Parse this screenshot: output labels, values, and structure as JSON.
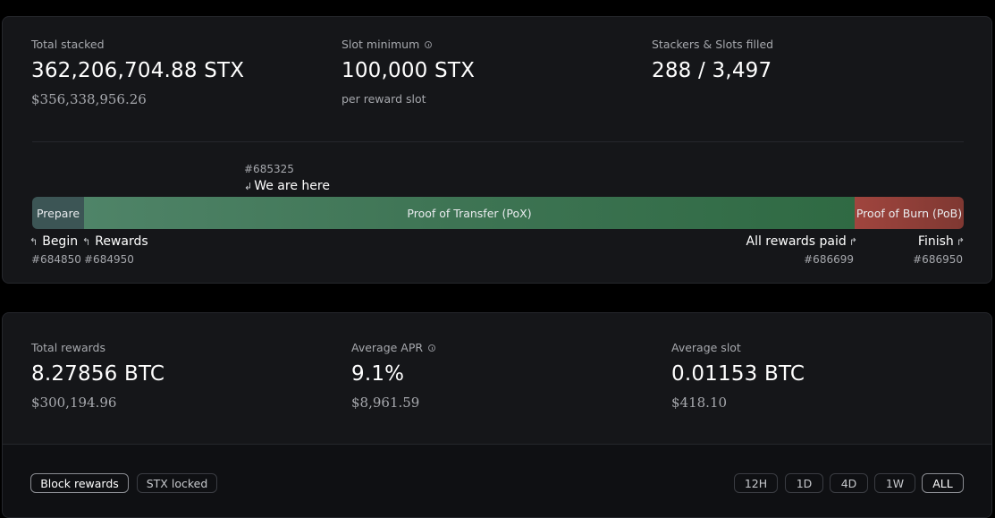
{
  "cycle": {
    "total_stacked": {
      "label": "Total stacked",
      "value": "362,206,704.88 STX",
      "usd": "$356,338,956.26"
    },
    "slot_minimum": {
      "label": "Slot minimum",
      "value": "100,000 STX",
      "sub": "per reward slot"
    },
    "stackers_slots": {
      "label": "Stackers & Slots filled",
      "value": "288 / 3,497"
    },
    "current_block": "#685325",
    "current_label": "We are here",
    "timeline": {
      "prepare": "Prepare",
      "pox": "Proof of Transfer (PoX)",
      "pob": "Proof of Burn (PoB)"
    },
    "milestones": {
      "begin": {
        "label": "Begin",
        "block": "#684850"
      },
      "rewards": {
        "label": "Rewards",
        "block": "#684950"
      },
      "all_paid": {
        "label": "All rewards paid",
        "block": "#686699"
      },
      "finish": {
        "label": "Finish",
        "block": "#686950"
      }
    }
  },
  "rewards": {
    "total_rewards": {
      "label": "Total rewards",
      "value": "8.27856 BTC",
      "usd": "$300,194.96"
    },
    "average_apr": {
      "label": "Average APR",
      "value": "9.1%",
      "usd": "$8,961.59"
    },
    "average_slot": {
      "label": "Average slot",
      "value": "0.01153 BTC",
      "usd": "$418.10"
    }
  },
  "chart_tabs": [
    "Block rewards",
    "STX locked"
  ],
  "active_chart_tab": "Block rewards",
  "ranges": [
    "12H",
    "1D",
    "4D",
    "1W",
    "ALL"
  ],
  "active_range": "ALL",
  "colors": {
    "prepare": "#3c5555",
    "pox": "#3f7555",
    "pob": "#a0453e",
    "card_bg": "#151619"
  }
}
